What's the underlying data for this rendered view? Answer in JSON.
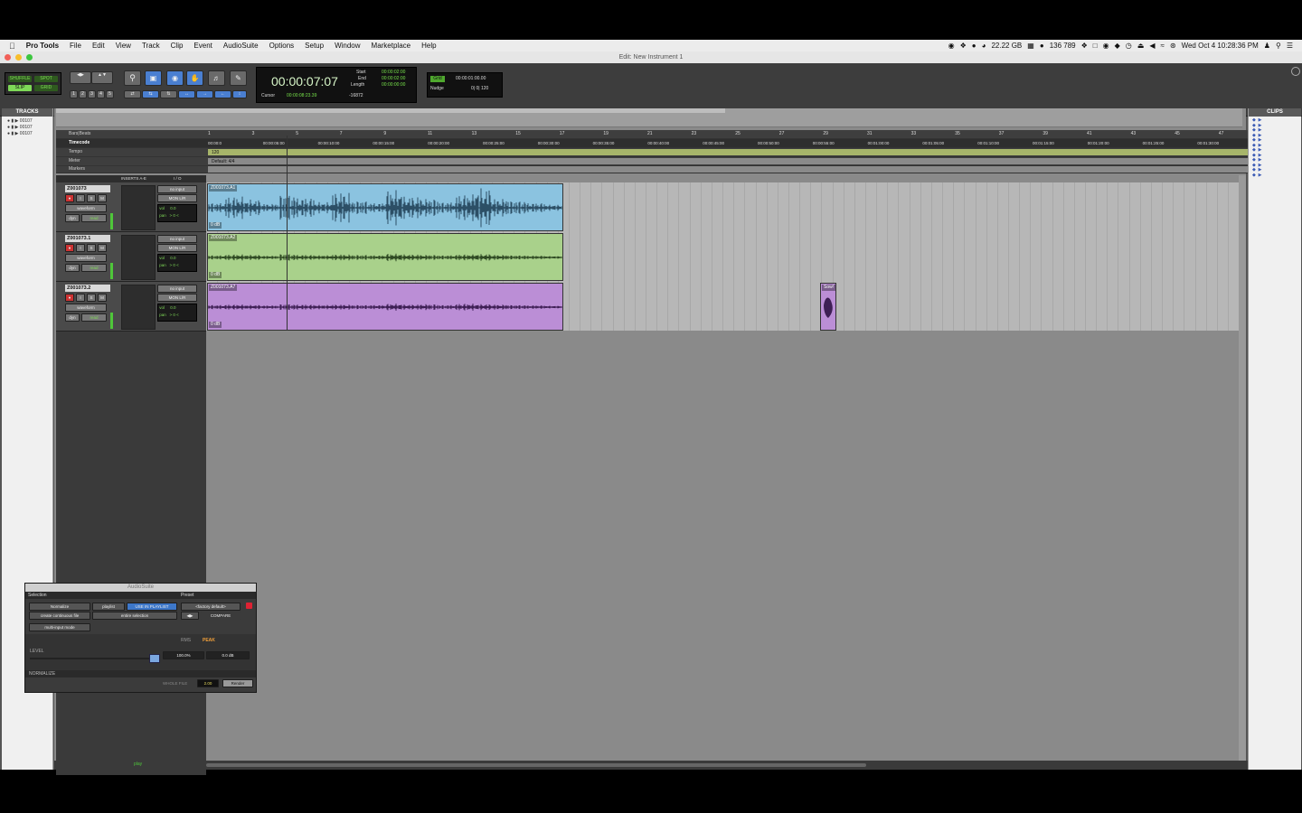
{
  "menubar": {
    "app": "Pro Tools",
    "items": [
      "File",
      "Edit",
      "View",
      "Track",
      "Clip",
      "Event",
      "AudioSuite",
      "Options",
      "Setup",
      "Window",
      "Marketplace",
      "Help"
    ],
    "status": {
      "disk": "22.22 GB",
      "count": "136 789",
      "datetime": "Wed Oct 4  10:28:36 PM"
    }
  },
  "window": {
    "title": "Edit: New Instrument 1"
  },
  "toolbar": {
    "modes": {
      "shuffle": "SHUFFLE",
      "spot": "SPOT",
      "slip": "SLIP",
      "grid": "GRID"
    },
    "zoom_presets": [
      "1",
      "2",
      "3",
      "4",
      "5"
    ],
    "counter": "00:00:07:07",
    "start_label": "Start",
    "end_label": "End",
    "length_label": "Length",
    "start": "00:00:02:00",
    "end": "00:00:02:00",
    "length": "00:00:00:00",
    "cursor_label": "Cursor",
    "cursor": "00:00:08:23.39",
    "cursor_value": "-16872",
    "grid_label": "Grid",
    "grid_value": "00:00:01:00.00",
    "nudge_label": "Nudge",
    "nudge_value": "0| 0| 120"
  },
  "panels": {
    "tracks": "TRACKS",
    "clips": "CLIPS",
    "tracks_list": [
      "00107",
      "00107",
      "00107"
    ]
  },
  "rulers": {
    "bars_beats": "Bars|Beats",
    "timecode": "Timecode",
    "tempo": "Tempo",
    "meter": "Meter",
    "markers": "Markers",
    "tempo_value": "120",
    "meter_value": "Default: 4/4",
    "bar_numbers": [
      "1",
      "3",
      "5",
      "7",
      "9",
      "11",
      "13",
      "15",
      "17",
      "19",
      "21",
      "23",
      "25",
      "27",
      "29",
      "31",
      "33",
      "35",
      "37",
      "39",
      "41",
      "43",
      "45",
      "47"
    ],
    "timecodes": [
      "00:00:0",
      "00:00:05:00",
      "00:00:10:00",
      "00:00:15:00",
      "00:00:20:00",
      "00:00:25:00",
      "00:00:30:00",
      "00:00:35:00",
      "00:00:40:00",
      "00:00:45:00",
      "00:00:50:00",
      "00:00:55:00",
      "00:01:00:00",
      "00:01:05:00",
      "00:01:10:00",
      "00:01:15:00",
      "00:01:20:00",
      "00:01:25:00",
      "00:01:30:00"
    ]
  },
  "column_headers": {
    "inserts": "INSERTS A-E",
    "io": "I / O"
  },
  "tracks": [
    {
      "name": "Z001073",
      "input": "no input",
      "output": "MON L/R",
      "view": "waveform",
      "vol_label": "vol",
      "vol": "0.0",
      "pan_label": "pan",
      "pan": "> 0 <",
      "dyn": "dyn",
      "mode": "read",
      "clip": "Z001073.A1",
      "gain": "0 dB",
      "color": "#8bc3e0",
      "wave": "#2c4f66"
    },
    {
      "name": "Z001073.1",
      "input": "no input",
      "output": "MON L/R",
      "view": "waveform",
      "vol_label": "vol",
      "vol": "0.0",
      "pan_label": "pan",
      "pan": "> 0 <",
      "dyn": "dyn",
      "mode": "read",
      "clip": "Z001073.A2",
      "gain": "0 dB",
      "color": "#a9d18b",
      "wave": "#2f4a23"
    },
    {
      "name": "Z001073.2",
      "input": "no input",
      "output": "MON L/R",
      "view": "waveform",
      "vol_label": "vol",
      "vol": "0.0",
      "pan_label": "pan",
      "pan": "> 0 <",
      "dyn": "dyn",
      "mode": "read",
      "clip": "Z001073.A7",
      "gain": "0 dB",
      "color": "#bb8ed6",
      "wave": "#3e1f55"
    }
  ],
  "small_clip": {
    "name": "Sow!"
  },
  "audiosuite": {
    "title": "AudioSuite",
    "selection_label": "Selection",
    "preset_label": "Preset",
    "plugin": "Normalize",
    "playlist": "playlist",
    "use_in_playlist": "USE IN PLAYLIST",
    "preset": "<factory default>",
    "continuous": "create continuous file",
    "selection_mode": "entire selection",
    "compare": "COMPARE",
    "multi_input": "multi-input mode",
    "rms": "RMS",
    "peak": "PEAK",
    "level_label": "LEVEL",
    "level_pct": "100.0%",
    "level_db": "0.0 dB",
    "plugin_name": "NORMALIZE",
    "handle_label": "WHOLE FILE",
    "handle_value": "2.00",
    "render": "Render"
  },
  "bottom": {
    "play": "play"
  }
}
